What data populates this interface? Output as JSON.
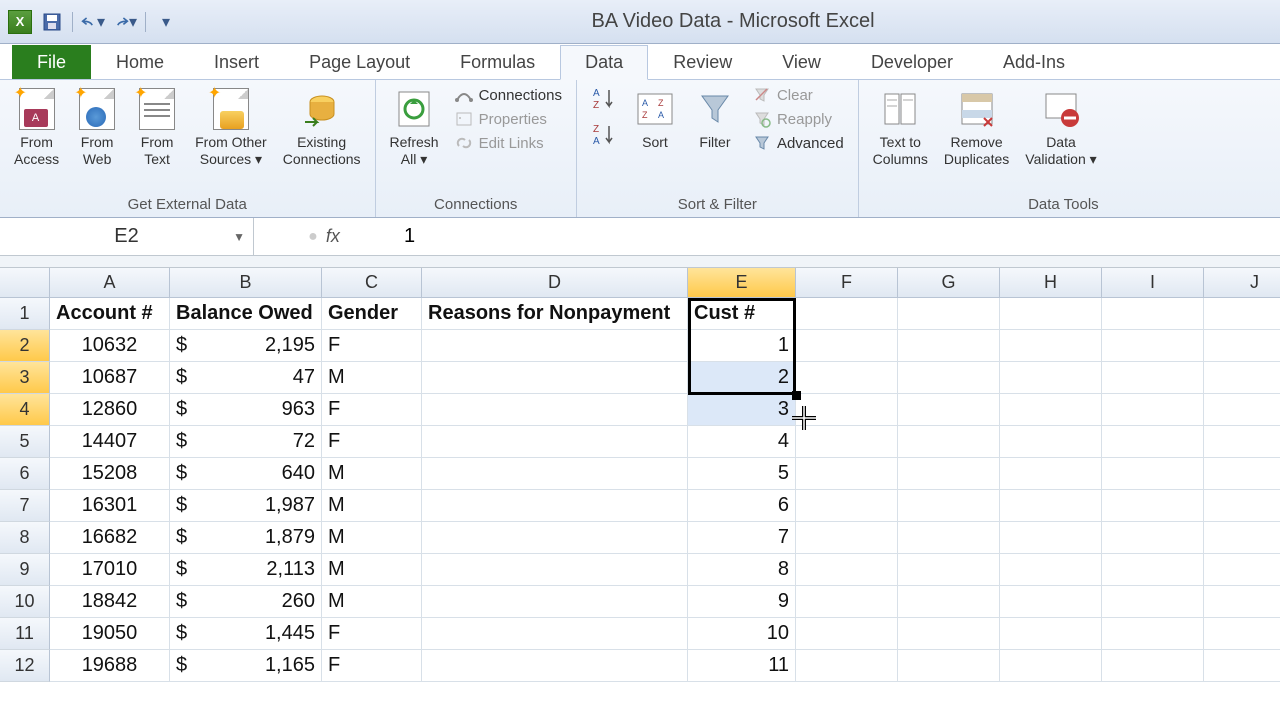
{
  "app": {
    "title": "BA Video Data  -  Microsoft Excel"
  },
  "tabs": [
    "File",
    "Home",
    "Insert",
    "Page Layout",
    "Formulas",
    "Data",
    "Review",
    "View",
    "Developer",
    "Add-Ins"
  ],
  "active_tab": "Data",
  "ribbon": {
    "group1_label": "Get External Data",
    "from_access": "From\nAccess",
    "from_web": "From\nWeb",
    "from_text": "From\nText",
    "from_other": "From Other\nSources",
    "existing_conn": "Existing\nConnections",
    "group2_label": "Connections",
    "refresh_all": "Refresh\nAll",
    "connections": "Connections",
    "properties": "Properties",
    "edit_links": "Edit Links",
    "group3_label": "Sort & Filter",
    "sort": "Sort",
    "filter": "Filter",
    "clear": "Clear",
    "reapply": "Reapply",
    "advanced": "Advanced",
    "group4_label": "Data Tools",
    "text_to_cols": "Text to\nColumns",
    "remove_dup": "Remove\nDuplicates",
    "data_val": "Data\nValidation"
  },
  "namebox": "E2",
  "formula_value": "1",
  "columns": [
    "A",
    "B",
    "C",
    "D",
    "E",
    "F",
    "G",
    "H",
    "I",
    "J"
  ],
  "selected_col": "E",
  "selected_rows": [
    2,
    3,
    4
  ],
  "headers": {
    "A": "Account #",
    "B": "Balance Owed",
    "C": "Gender",
    "D": "Reasons for Nonpayment",
    "E": "Cust #"
  },
  "chart_data": {
    "type": "table",
    "columns": [
      "Account #",
      "Balance Owed",
      "Gender",
      "Reasons for Nonpayment",
      "Cust #"
    ],
    "rows": [
      {
        "account": "10632",
        "balance": "2,195",
        "gender": "F",
        "reason": "",
        "cust": "1"
      },
      {
        "account": "10687",
        "balance": "47",
        "gender": "M",
        "reason": "",
        "cust": "2"
      },
      {
        "account": "12860",
        "balance": "963",
        "gender": "F",
        "reason": "",
        "cust": "3"
      },
      {
        "account": "14407",
        "balance": "72",
        "gender": "F",
        "reason": "",
        "cust": "4"
      },
      {
        "account": "15208",
        "balance": "640",
        "gender": "M",
        "reason": "",
        "cust": "5"
      },
      {
        "account": "16301",
        "balance": "1,987",
        "gender": "M",
        "reason": "",
        "cust": "6"
      },
      {
        "account": "16682",
        "balance": "1,879",
        "gender": "M",
        "reason": "",
        "cust": "7"
      },
      {
        "account": "17010",
        "balance": "2,113",
        "gender": "M",
        "reason": "",
        "cust": "8"
      },
      {
        "account": "18842",
        "balance": "260",
        "gender": "M",
        "reason": "",
        "cust": "9"
      },
      {
        "account": "19050",
        "balance": "1,445",
        "gender": "F",
        "reason": "",
        "cust": "10"
      },
      {
        "account": "19688",
        "balance": "1,165",
        "gender": "F",
        "reason": "",
        "cust": "11"
      }
    ]
  }
}
